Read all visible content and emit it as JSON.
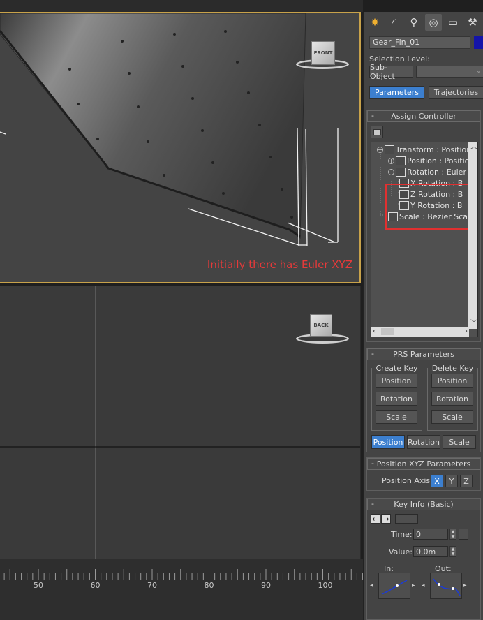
{
  "viewport_top": {
    "annotation": "Initially there has Euler XYZ",
    "viewcube_label": "FRONT"
  },
  "viewport_bottom": {
    "viewcube_label": "BACK"
  },
  "timeline": {
    "ticks": [
      "50",
      "60",
      "70",
      "80",
      "90",
      "100"
    ]
  },
  "command_panel": {
    "tabs": [
      {
        "name": "create-tab",
        "glyph": "✸"
      },
      {
        "name": "modify-tab",
        "glyph": "◜"
      },
      {
        "name": "hierarchy-tab",
        "glyph": "⚲"
      },
      {
        "name": "motion-tab",
        "glyph": "◎"
      },
      {
        "name": "display-tab",
        "glyph": "▭"
      },
      {
        "name": "utilities-tab",
        "glyph": "⚒"
      }
    ],
    "object_name": "Gear_Fin_01",
    "object_color": "#1414a8",
    "selection_level_label": "Selection Level:",
    "sub_object_label": "Sub-Object",
    "parameters_label": "Parameters",
    "trajectories_label": "Trajectories",
    "assign_controller": {
      "title": "Assign Controller",
      "tree": [
        {
          "label": "Transform : Position/",
          "level": 0,
          "pm": "⊖"
        },
        {
          "label": "Position : Position",
          "level": 1,
          "pm": "⊕"
        },
        {
          "label": "Rotation : Euler X",
          "level": 1,
          "pm": "⊖"
        },
        {
          "label": "X Rotation : B",
          "level": 2,
          "pm": ""
        },
        {
          "label": "Z Rotation : B",
          "level": 2,
          "pm": ""
        },
        {
          "label": "Y Rotation : B",
          "level": 2,
          "pm": ""
        },
        {
          "label": "Scale : Bezier Sca",
          "level": 1,
          "pm": ""
        }
      ]
    },
    "prs_parameters": {
      "title": "PRS Parameters",
      "create_key_label": "Create Key",
      "delete_key_label": "Delete Key",
      "create_buttons": [
        "Position",
        "Rotation",
        "Scale"
      ],
      "delete_buttons": [
        "Position",
        "Rotation",
        "Scale"
      ],
      "mode_tabs": [
        "Position",
        "Rotation",
        "Scale"
      ],
      "active_mode": "Position"
    },
    "position_xyz": {
      "title": "Position XYZ Parameters",
      "axis_label": "Position Axis:",
      "axes": [
        "X",
        "Y",
        "Z"
      ],
      "active_axis": "X"
    },
    "key_info": {
      "title": "Key Info (Basic)",
      "time_label": "Time:",
      "time_value": "0",
      "value_label": "Value:",
      "value_value": "0.0m",
      "in_label": "In:",
      "out_label": "Out:"
    },
    "minus_symbol": "-",
    "accent": "#3c7fcf",
    "highlight": "#e03030"
  }
}
